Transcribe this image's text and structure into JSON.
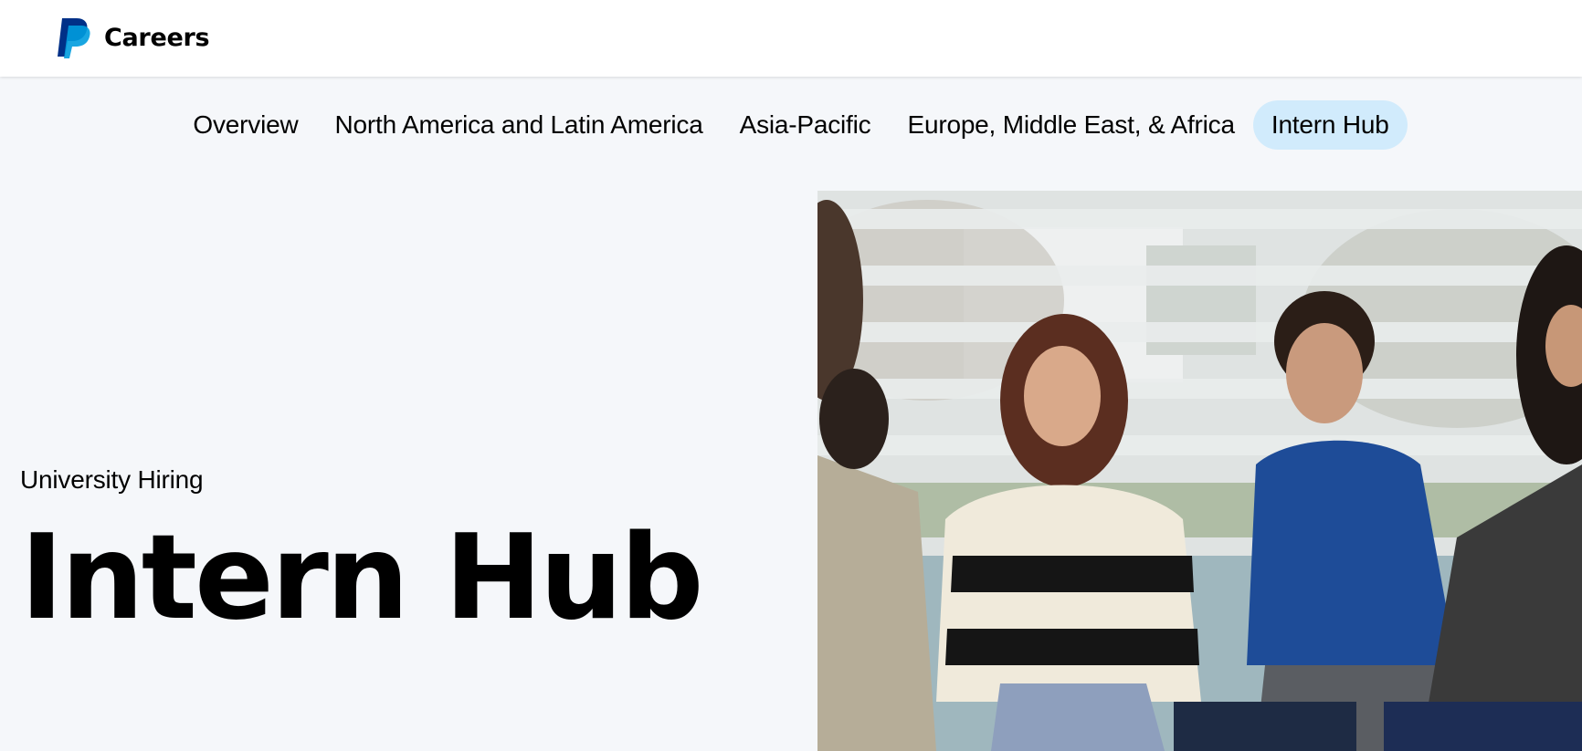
{
  "header": {
    "logo_icon": "paypal-logo-icon",
    "brand_label": "Careers"
  },
  "subnav": {
    "items": [
      {
        "label": "Overview",
        "active": false
      },
      {
        "label": "North America and Latin America",
        "active": false
      },
      {
        "label": "Asia-Pacific",
        "active": false
      },
      {
        "label": "Europe, Middle East, & Africa",
        "active": false
      },
      {
        "label": "Intern Hub",
        "active": true
      }
    ]
  },
  "hero": {
    "eyebrow": "University Hiring",
    "title": "Intern Hub",
    "image_icon": "photo-icon"
  },
  "colors": {
    "page_bg": "#f5f7fa",
    "header_bg": "#ffffff",
    "active_pill": "#d1ebfc",
    "logo_dark": "#003087",
    "logo_light": "#009cde"
  }
}
